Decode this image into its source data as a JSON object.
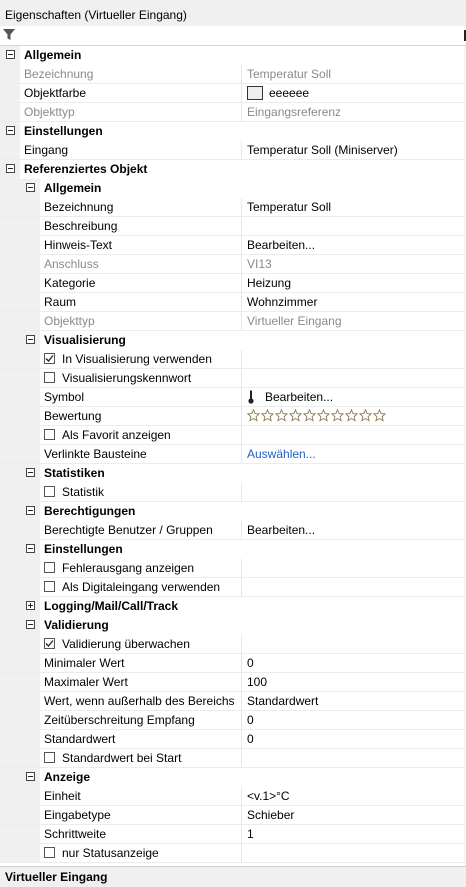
{
  "panel": {
    "title": "Eigenschaften (Virtueller Eingang)"
  },
  "filter": {
    "icon": "filter-icon"
  },
  "footer": {
    "title": "Virtueller Eingang"
  },
  "colors": {
    "link": "#1d62c7",
    "disabled": "#8a8a8a",
    "gutter": "#f0f0f0"
  },
  "rows": [
    {
      "type": "cat",
      "level": 1,
      "label": "Allgemein",
      "expanded": true
    },
    {
      "type": "prop",
      "level": 1,
      "label": "Bezeichnung",
      "value": "Temperatur Soll",
      "disabled": true
    },
    {
      "type": "prop",
      "level": 1,
      "label": "Objektfarbe",
      "value": "eeeeee",
      "swatch": true
    },
    {
      "type": "prop",
      "level": 1,
      "label": "Objekttyp",
      "value": "Eingangsreferenz",
      "disabled": true
    },
    {
      "type": "cat",
      "level": 1,
      "label": "Einstellungen",
      "expanded": true
    },
    {
      "type": "prop",
      "level": 1,
      "label": "Eingang",
      "value": "Temperatur Soll (Miniserver)"
    },
    {
      "type": "cat",
      "level": 1,
      "label": "Referenziertes Objekt",
      "expanded": true
    },
    {
      "type": "cat",
      "level": 2,
      "label": "Allgemein",
      "expanded": true
    },
    {
      "type": "prop",
      "level": 2,
      "label": "Bezeichnung",
      "value": "Temperatur Soll"
    },
    {
      "type": "prop",
      "level": 2,
      "label": "Beschreibung",
      "value": ""
    },
    {
      "type": "prop",
      "level": 2,
      "label": "Hinweis-Text",
      "value": "Bearbeiten..."
    },
    {
      "type": "prop",
      "level": 2,
      "label": "Anschluss",
      "value": "VI13",
      "disabled": true
    },
    {
      "type": "prop",
      "level": 2,
      "label": "Kategorie",
      "value": "Heizung"
    },
    {
      "type": "prop",
      "level": 2,
      "label": "Raum",
      "value": "Wohnzimmer"
    },
    {
      "type": "prop",
      "level": 2,
      "label": "Objekttyp",
      "value": "Virtueller Eingang",
      "disabled": true
    },
    {
      "type": "cat",
      "level": 2,
      "label": "Visualisierung",
      "expanded": true
    },
    {
      "type": "check",
      "level": 2,
      "label": "In Visualisierung verwenden",
      "checked": true
    },
    {
      "type": "check",
      "level": 2,
      "label": "Visualisierungskennwort",
      "checked": false
    },
    {
      "type": "prop",
      "level": 2,
      "label": "Symbol",
      "value": "Bearbeiten...",
      "icon": "thermometer-icon"
    },
    {
      "type": "prop",
      "level": 2,
      "label": "Bewertung",
      "value": "",
      "rating": 0,
      "rating_max": 10
    },
    {
      "type": "check",
      "level": 2,
      "label": "Als Favorit anzeigen",
      "checked": false
    },
    {
      "type": "prop",
      "level": 2,
      "label": "Verlinkte Bausteine",
      "value": "Auswählen...",
      "link": true
    },
    {
      "type": "cat",
      "level": 2,
      "label": "Statistiken",
      "expanded": true
    },
    {
      "type": "check",
      "level": 2,
      "label": "Statistik",
      "checked": false
    },
    {
      "type": "cat",
      "level": 2,
      "label": "Berechtigungen",
      "expanded": true
    },
    {
      "type": "prop",
      "level": 2,
      "label": "Berechtigte Benutzer / Gruppen",
      "value": "Bearbeiten..."
    },
    {
      "type": "cat",
      "level": 2,
      "label": "Einstellungen",
      "expanded": true
    },
    {
      "type": "check",
      "level": 2,
      "label": "Fehlerausgang anzeigen",
      "checked": false
    },
    {
      "type": "check",
      "level": 2,
      "label": "Als Digitaleingang verwenden",
      "checked": false
    },
    {
      "type": "cat",
      "level": 2,
      "label": "Logging/Mail/Call/Track",
      "expanded": false
    },
    {
      "type": "cat",
      "level": 2,
      "label": "Validierung",
      "expanded": true
    },
    {
      "type": "check",
      "level": 2,
      "label": "Validierung überwachen",
      "checked": true
    },
    {
      "type": "prop",
      "level": 2,
      "label": "Minimaler Wert",
      "value": "0"
    },
    {
      "type": "prop",
      "level": 2,
      "label": "Maximaler Wert",
      "value": "100"
    },
    {
      "type": "prop",
      "level": 2,
      "label": "Wert, wenn außerhalb des Bereichs",
      "value": "Standardwert"
    },
    {
      "type": "prop",
      "level": 2,
      "label": "Zeitüberschreitung Empfang",
      "value": "0"
    },
    {
      "type": "prop",
      "level": 2,
      "label": "Standardwert",
      "value": "0"
    },
    {
      "type": "check",
      "level": 2,
      "label": "Standardwert bei Start",
      "checked": false
    },
    {
      "type": "cat",
      "level": 2,
      "label": "Anzeige",
      "expanded": true
    },
    {
      "type": "prop",
      "level": 2,
      "label": "Einheit",
      "value": "<v.1>°C"
    },
    {
      "type": "prop",
      "level": 2,
      "label": "Eingabetype",
      "value": "Schieber"
    },
    {
      "type": "prop",
      "level": 2,
      "label": "Schrittweite",
      "value": "1"
    },
    {
      "type": "check",
      "level": 2,
      "label": "nur Statusanzeige",
      "checked": false
    }
  ]
}
